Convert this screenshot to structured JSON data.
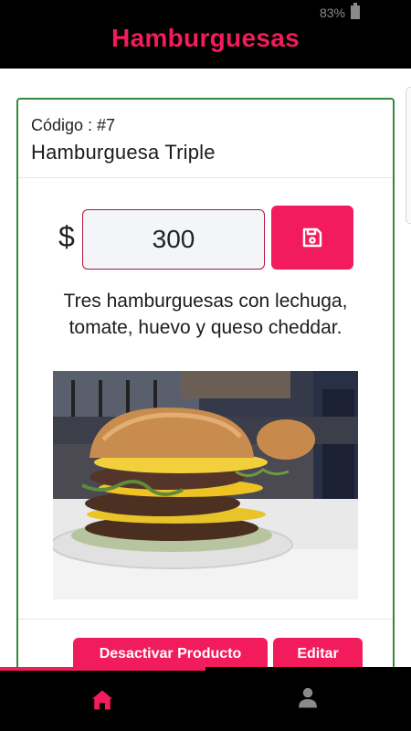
{
  "status_bar": {
    "battery": "83%"
  },
  "app_bar": {
    "title": "Hamburguesas"
  },
  "product": {
    "code_label": "Código : #7",
    "name": "Hamburguesa Triple",
    "currency": "$",
    "price": "300",
    "description": "Tres hamburguesas con lechuga, tomate, huevo y queso cheddar.",
    "image_alt": "Hamburguesa Triple photo"
  },
  "actions": {
    "deactivate_label": "Desactivar Producto",
    "edit_label": "Editar"
  },
  "loading": {
    "progress_fraction": 0.5
  },
  "bottom_nav": {
    "items": [
      {
        "name": "home",
        "icon": "home-icon",
        "active": true
      },
      {
        "name": "profile",
        "icon": "person-icon",
        "active": false
      }
    ]
  },
  "colors": {
    "accent": "#f21c5c",
    "card_border": "#2e8b3a",
    "bar_background": "#000000",
    "nav_inactive": "#8a8a8a"
  }
}
